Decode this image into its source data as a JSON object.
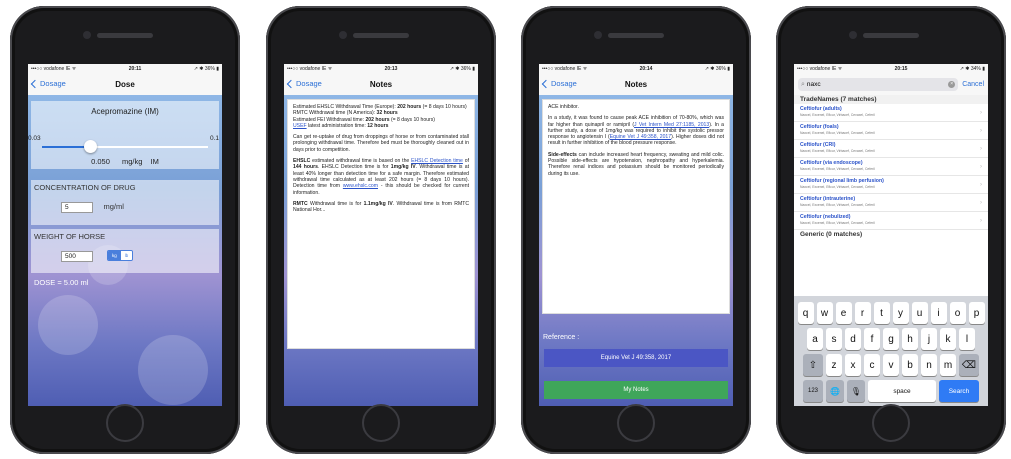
{
  "phones": [
    {
      "status": {
        "carrier": "•••○○ vodafone IE ᯤ",
        "time": "20:11",
        "right": "↗ ✱ 36% ▮"
      },
      "nav": {
        "back_label": "Dosage",
        "title": "Dose"
      },
      "drug_name": "Acepromazine (IM)",
      "slider": {
        "min_label": "0.03",
        "max_label": "0.1",
        "value_fraction": 0.29
      },
      "dose_value": "0.050",
      "dose_unit": "mg/kg",
      "route": "IM",
      "concentration": {
        "label": "CONCENTRATION OF DRUG",
        "value": "5",
        "unit": "mg/ml"
      },
      "weight": {
        "label": "WEIGHT OF HORSE",
        "value": "500",
        "unit_options": [
          "kg",
          "lb"
        ],
        "selected_unit": "kg"
      },
      "result": "DOSE = 5.00 ml"
    },
    {
      "status": {
        "carrier": "•••○○ vodafone IE ᯤ",
        "time": "20:13",
        "right": "↗ ✱ 36% ▮"
      },
      "nav": {
        "back_label": "Dosage",
        "title": "Notes"
      },
      "p1": {
        "a": "Estimated EHSLC Withdrawal Time (Europe): ",
        "b": "202 hours",
        "c": " (= 8 days 10 hours)"
      },
      "p2": {
        "a": "RMTC Withdrawal time (N America): ",
        "b": "32 hours"
      },
      "p3": {
        "a": "Estimated FEI Withdrawal time: ",
        "b": "202 hours",
        "c": " (= 8 days 10 hours)"
      },
      "p4": {
        "link": "USEF",
        "a": " latest administration time: ",
        "b": "12 hours"
      },
      "p5": "Can get re-uptake of drug from droppings of horse or from contaminated stall prolonging withdrawal time. Therefore bed must be thoroughly cleaned out in days prior to competition.",
      "p6": {
        "b1": "EHSLC",
        "a": " estimated withdrawal time is based on the ",
        "link1": "EHSLC Detection time",
        "c": " of ",
        "b2": "144 hours",
        "d": ". EHSLC Detection time is for ",
        "b3": "1mg/kg IV",
        "e": ". Withdrawal time is at least 40% longer than detection time for a safe margin. Therefore estimated withdrawal time calculated as at least 202 hours (= 8 days 10 hours). Detection time from ",
        "link2": "www.ehslc.com",
        "f": " - this should be checked for current information."
      },
      "p7": {
        "b1": "RMTC",
        "a": " Withdrawal time is for ",
        "b2": "1.1mg/kg IV",
        "c": ". Withdrawal time is from RMTC National Hor..."
      }
    },
    {
      "status": {
        "carrier": "•••○○ vodafone IE ᯤ",
        "time": "20:14",
        "right": "↗ ✱ 36% ▮"
      },
      "nav": {
        "back_label": "Dosage",
        "title": "Notes"
      },
      "p1": "ACE inhibitor.",
      "p2": {
        "a": "In a study, it was found to cause peak ACE inhibition of 70-80%, which was far higher than quinapril or ramipril (",
        "link1": "J Vet Intern Med 27:1185, 2013",
        "b": "). In a further study, a dose of 1mg/kg was required to inhibit the systolic pressor response to angiotensin I (",
        "link2": "Equine Vet J 49:358, 2017",
        "c": "). Higher doses did not result in further inhibition of the blood pressure response."
      },
      "p3": {
        "b": "Side-effects",
        "a": " can include increased heart frequency, sweating and mild colic. Possible side-effects are hypotension, nephropathy and hyperkalemia. Therefore renal indices and potassium should be monitored periodically during its use."
      },
      "reference_label": "Reference :",
      "reference_button": "Equine Vet J 49:358, 2017",
      "notes_button": "My Notes"
    },
    {
      "status": {
        "carrier": "•••○○ vodafone IE ᯤ",
        "time": "20:15",
        "right": "↗ ✱ 34% ▮"
      },
      "search": {
        "value": "naxc",
        "cancel": "Cancel"
      },
      "tradenames_header": "TradeNames (7 matches)",
      "results": [
        {
          "title": "Ceftiofur (adults)",
          "sub": "Naxcel, Excenel, Eficur, Virbacef, Cevaxel, Ceferil"
        },
        {
          "title": "Ceftiofur (foals)",
          "sub": "Naxcel, Excenel, Eficur, Virbacef, Cevaxel, Ceferil"
        },
        {
          "title": "Ceftiofur (CRI)",
          "sub": "Naxcel, Excenel, Eficur, Virbacef, Cevaxel, Ceferil"
        },
        {
          "title": "Ceftiofur (via endoscope)",
          "sub": "Naxcel, Excenel, Eficur, Virbacef, Cevaxel, Ceferil"
        },
        {
          "title": "Ceftiofur (regional limb perfusion)",
          "sub": "Naxcel, Excenel, Eficur, Virbacef, Cevaxel, Ceferil"
        },
        {
          "title": "Ceftiofur (intrauterine)",
          "sub": "Naxcel, Excenel, Eficur, Virbacef, Cevaxel, Ceferil"
        },
        {
          "title": "Ceftiofur (nebulized)",
          "sub": "Naxcel, Excenel, Eficur, Virbacef, Cevaxel, Ceferil"
        }
      ],
      "generic_header": "Generic (0 matches)",
      "keyboard": {
        "row1": [
          "q",
          "w",
          "e",
          "r",
          "t",
          "y",
          "u",
          "i",
          "o",
          "p"
        ],
        "row2": [
          "a",
          "s",
          "d",
          "f",
          "g",
          "h",
          "j",
          "k",
          "l"
        ],
        "row3": [
          "z",
          "x",
          "c",
          "v",
          "b",
          "n",
          "m"
        ],
        "shift": "⇧",
        "backspace": "⌫",
        "numbers": "123",
        "globe": "🌐",
        "mic": "🎙",
        "space": "space",
        "search": "Search"
      }
    }
  ],
  "colors": {
    "ios_blue": "#2b6fd6",
    "reference_button": "#4b56c4",
    "notes_button": "#3fa65a",
    "search_key": "#2f7bf5"
  }
}
